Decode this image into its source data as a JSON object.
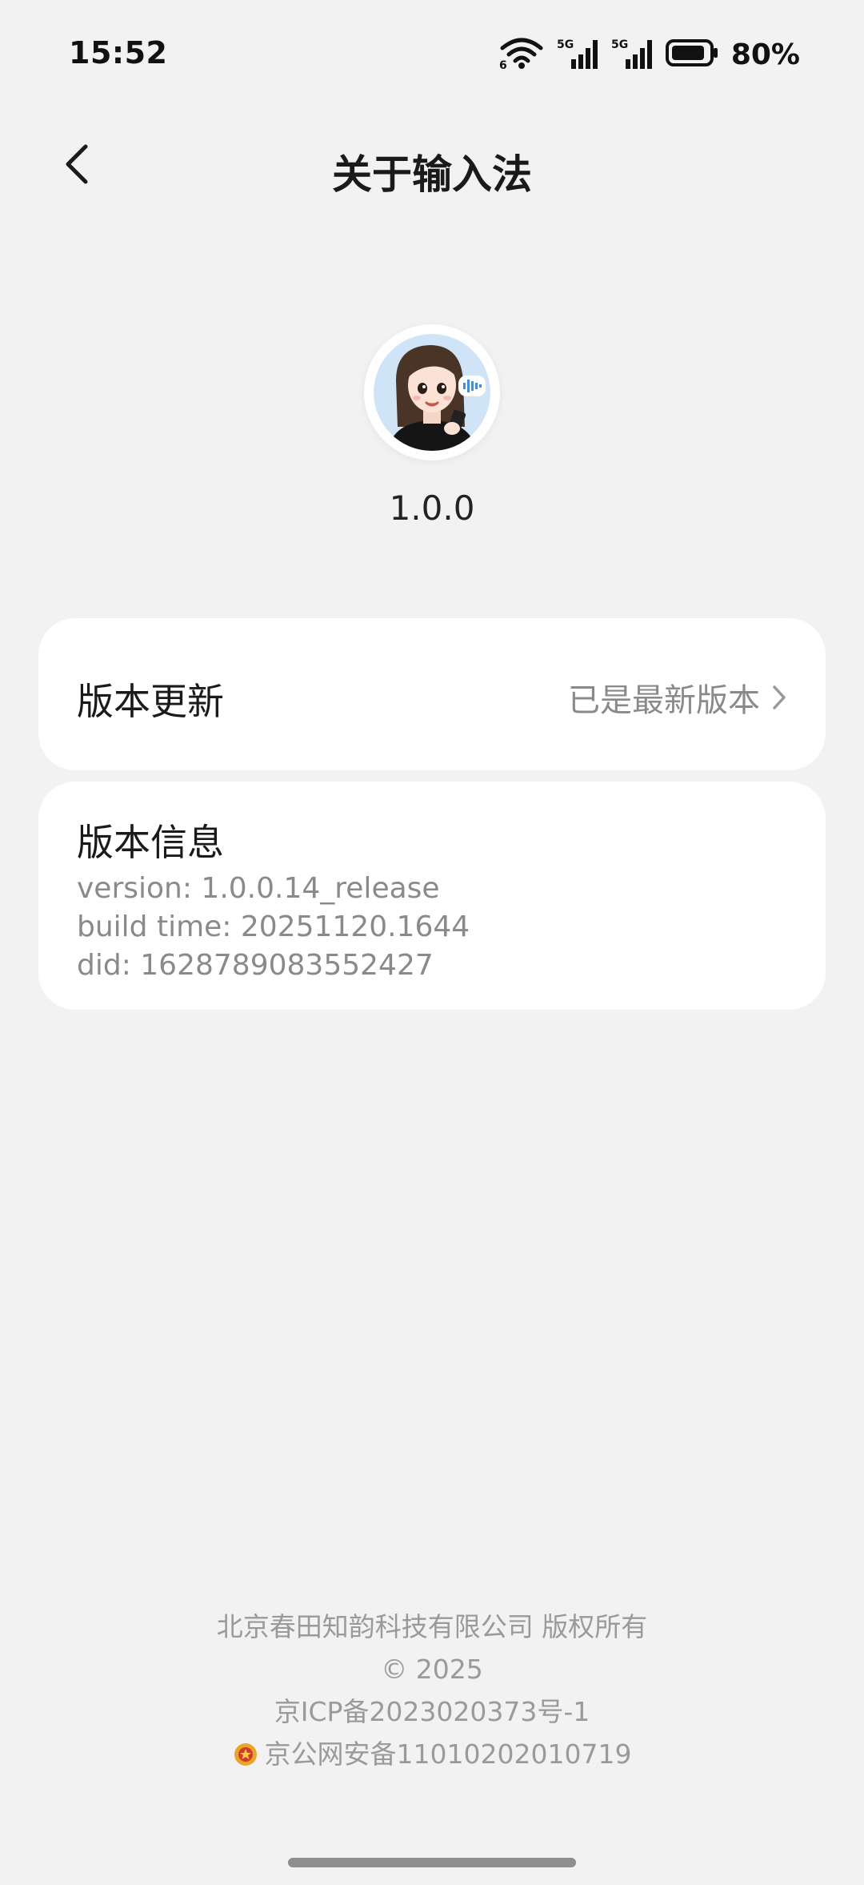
{
  "status_bar": {
    "time": "15:52",
    "battery": "80%",
    "wifi_icon": "wifi-icon",
    "signal_icons": [
      "5G",
      "5G"
    ]
  },
  "header": {
    "title": "关于输入法",
    "back_icon": "back-arrow-icon"
  },
  "app": {
    "logo_icon": "assistant-avatar-icon",
    "version": "1.0.0"
  },
  "update_card": {
    "label": "版本更新",
    "status": "已是最新版本"
  },
  "info_card": {
    "label": "版本信息",
    "lines": [
      "version: 1.0.0.14_release",
      "build time: 20251120.1644",
      "did: 1628789083552427"
    ]
  },
  "footer": {
    "company": "北京春田知韵科技有限公司 版权所有",
    "copyright": "© 2025",
    "icp": "京ICP备2023020373号-1",
    "police": "京公网安备11010202010719"
  },
  "colors": {
    "background": "#f2f2f2",
    "card": "#ffffff",
    "secondary_text": "#8a8a8a",
    "footer_text": "#9a9a9a"
  }
}
